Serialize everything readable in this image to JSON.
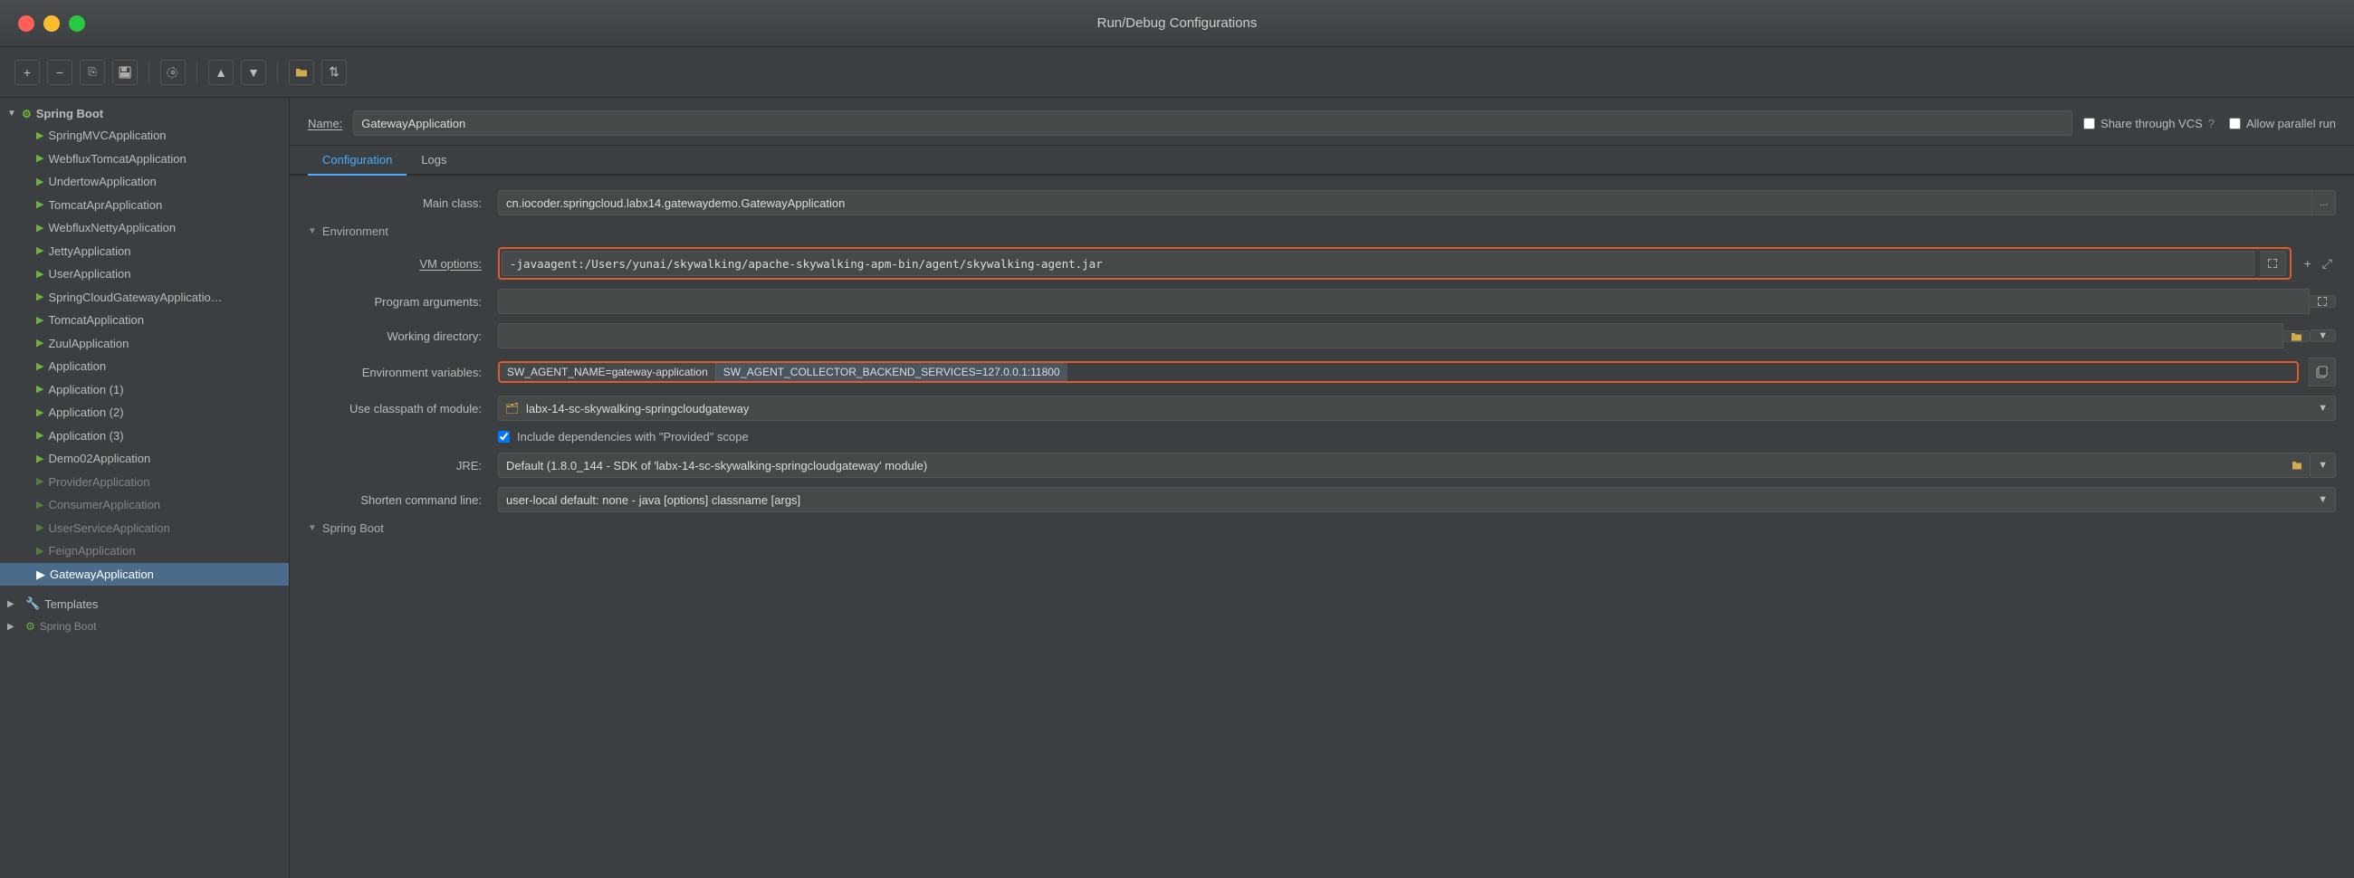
{
  "window": {
    "title": "Run/Debug Configurations",
    "buttons": {
      "close": "×",
      "minimize": "−",
      "maximize": "+"
    }
  },
  "toolbar": {
    "add_label": "+",
    "remove_label": "−",
    "copy_label": "⎘",
    "save_label": "💾",
    "wrench_label": "🔧",
    "up_label": "▲",
    "down_label": "▼",
    "folder_label": "📁",
    "sort_label": "⇅"
  },
  "sidebar": {
    "sections": [
      {
        "id": "spring-boot",
        "label": "Spring Boot",
        "expanded": true,
        "items": [
          {
            "id": "springmvc",
            "label": "SpringMVCApplication"
          },
          {
            "id": "webflux-tomcat",
            "label": "WebfluxTomcatApplication"
          },
          {
            "id": "undertow",
            "label": "UndertowApplication"
          },
          {
            "id": "tomcatapr",
            "label": "TomcatAprApplication"
          },
          {
            "id": "webflux-netty",
            "label": "WebfluxNettyApplication"
          },
          {
            "id": "jetty",
            "label": "JettyApplication"
          },
          {
            "id": "user",
            "label": "UserApplication"
          },
          {
            "id": "springcloud-gateway",
            "label": "SpringCloudGatewayApplicatio…"
          },
          {
            "id": "tomcat",
            "label": "TomcatApplication"
          },
          {
            "id": "zuul",
            "label": "ZuulApplication"
          },
          {
            "id": "application",
            "label": "Application"
          },
          {
            "id": "application1",
            "label": "Application (1)"
          },
          {
            "id": "application2",
            "label": "Application (2)"
          },
          {
            "id": "application3",
            "label": "Application (3)"
          },
          {
            "id": "demo02",
            "label": "Demo02Application"
          },
          {
            "id": "provider",
            "label": "ProviderApplication",
            "dimmed": true
          },
          {
            "id": "consumer",
            "label": "ConsumerApplication",
            "dimmed": true
          },
          {
            "id": "userservice",
            "label": "UserServiceApplication",
            "dimmed": true
          },
          {
            "id": "feign",
            "label": "FeignApplication",
            "dimmed": true
          },
          {
            "id": "gateway",
            "label": "GatewayApplication",
            "selected": true
          }
        ]
      }
    ],
    "templates_label": "Templates",
    "spring_boot_bottom_label": "Spring Boot"
  },
  "config": {
    "name_label": "Name:",
    "name_value": "GatewayApplication",
    "share_vcs_label": "Share through VCS",
    "allow_parallel_label": "Allow parallel run",
    "tabs": [
      {
        "id": "configuration",
        "label": "Configuration",
        "active": true
      },
      {
        "id": "logs",
        "label": "Logs",
        "active": false
      }
    ],
    "fields": {
      "main_class_label": "Main class:",
      "main_class_value": "cn.iocoder.springcloud.labx14.gatewaydemo.GatewayApplication",
      "environment_label": "Environment",
      "vm_options_label": "VM options:",
      "vm_options_value": "-javaagent:/Users/yunai/skywalking/apache-skywalking-apm-bin/agent/skywalking-agent.jar",
      "program_args_label": "Program arguments:",
      "program_args_value": "",
      "working_dir_label": "Working directory:",
      "working_dir_value": "",
      "env_vars_label": "Environment variables:",
      "env_var_1": "SW_AGENT_NAME=gateway-application",
      "env_var_2": "SW_AGENT_COLLECTOR_BACKEND_SERVICES=127.0.0.1:11800",
      "classpath_label": "Use classpath of module:",
      "classpath_value": "labx-14-sc-skywalking-springcloudgateway",
      "include_deps_label": "Include dependencies with \"Provided\" scope",
      "jre_label": "JRE:",
      "jre_value": "Default (1.8.0_144 - SDK of 'labx-14-sc-skywalking-springcloudgateway' module)",
      "shorten_cmd_label": "Shorten command line:",
      "shorten_cmd_value": "user-local default: none - java [options] classname [args]",
      "spring_boot_label": "Spring Boot",
      "expand_label": "▴▾",
      "ellipsis_label": "..."
    }
  }
}
